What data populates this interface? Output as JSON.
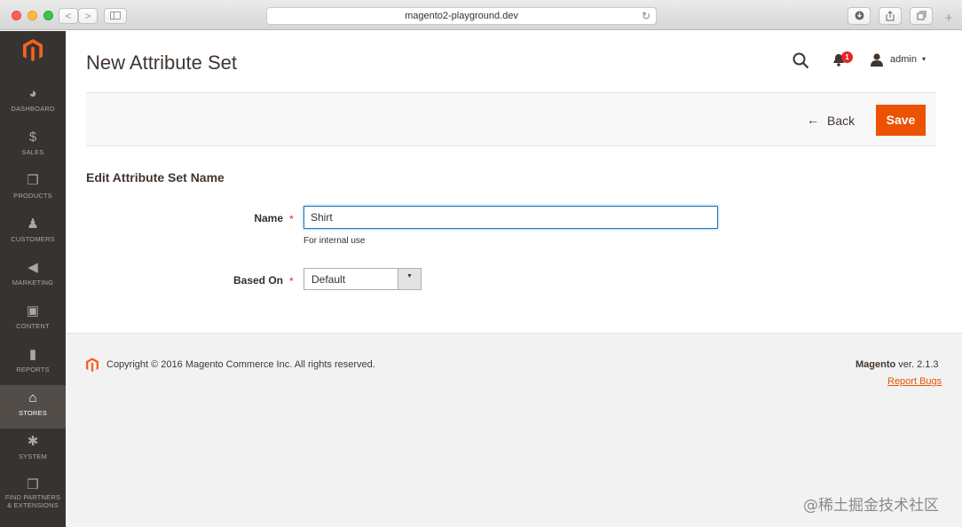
{
  "browser": {
    "url": "magento2-playground.dev",
    "back_glyph": "<",
    "forward_glyph": ">",
    "reload_glyph": "↻",
    "plus_glyph": "+"
  },
  "sidebar": {
    "items": [
      {
        "label": "DASHBOARD",
        "icon": "dashboard-icon",
        "glyph": "◕"
      },
      {
        "label": "SALES",
        "icon": "dollar-icon",
        "glyph": "$"
      },
      {
        "label": "PRODUCTS",
        "icon": "cube-icon",
        "glyph": "❒"
      },
      {
        "label": "CUSTOMERS",
        "icon": "person-icon",
        "glyph": "♟"
      },
      {
        "label": "MARKETING",
        "icon": "megaphone-icon",
        "glyph": "◀"
      },
      {
        "label": "CONTENT",
        "icon": "layout-icon",
        "glyph": "▣"
      },
      {
        "label": "REPORTS",
        "icon": "bar-chart-icon",
        "glyph": "▮"
      },
      {
        "label": "STORES",
        "icon": "store-icon",
        "glyph": "⌂",
        "active": true
      },
      {
        "label": "SYSTEM",
        "icon": "gear-icon",
        "glyph": "✱"
      },
      {
        "label": "FIND PARTNERS\n& EXTENSIONS",
        "label_line1": "FIND PARTNERS",
        "label_line2": "& EXTENSIONS",
        "icon": "box-icon",
        "glyph": "❒"
      }
    ]
  },
  "header": {
    "title": "New Attribute Set",
    "notification_count": "1",
    "user_name": "admin",
    "user_caret": "▾"
  },
  "actions": {
    "back_arrow": "←",
    "back_label": "Back",
    "save_label": "Save"
  },
  "form": {
    "section_title": "Edit Attribute Set Name",
    "name_label": "Name",
    "required_mark": "*",
    "name_value": "Shirt",
    "name_hint": "For internal use",
    "based_on_label": "Based On",
    "based_on_value": "Default",
    "select_caret": "▼"
  },
  "footer": {
    "copyright": "Copyright © 2016 Magento Commerce Inc. All rights reserved.",
    "version_brand": "Magento",
    "version_text": " ver. 2.1.3",
    "report_bugs": "Report Bugs"
  },
  "watermark": "@稀土掘金技术社区",
  "colors": {
    "sidebar_bg": "#373330",
    "accent": "#eb5202",
    "logo": "#f26322"
  }
}
